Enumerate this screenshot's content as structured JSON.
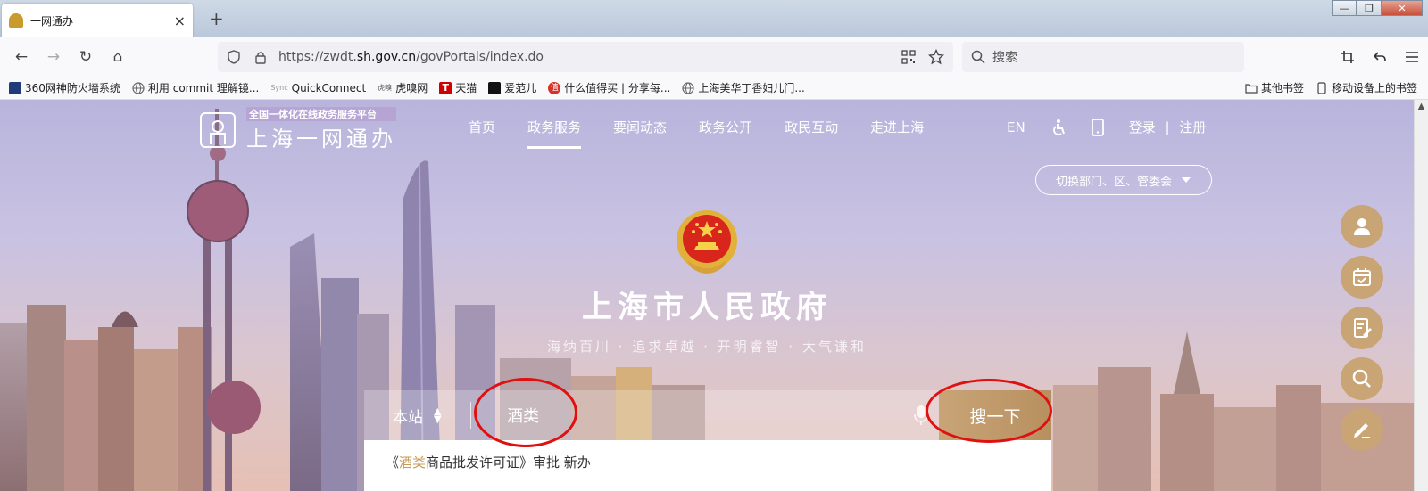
{
  "browser": {
    "tab": {
      "title": "一网通办",
      "close": "×"
    },
    "new_tab": "+",
    "window": {
      "minimize": "—",
      "restore": "❐",
      "close": "✕"
    },
    "nav": {
      "back": "←",
      "forward": "→",
      "reload": "↻",
      "home": "⌂"
    },
    "url": {
      "prefix": "https://zwdt.",
      "domain": "sh.gov.cn",
      "path": "/govPortals/index.do"
    },
    "search_placeholder": "搜索",
    "bookmarks": [
      {
        "label": "360网神防火墙系统",
        "color": "#1f3b7a"
      },
      {
        "label": "利用 commit 理解镜...",
        "color": "#777777"
      },
      {
        "label": "QuickConnect",
        "color": "#aaaaaa",
        "prefix": "Sync"
      },
      {
        "label": "虎嗅网",
        "color": "#555555",
        "prefix": "虎嗅"
      },
      {
        "label": "天猫",
        "color": "#d00000",
        "prefix": "T"
      },
      {
        "label": "爱范儿",
        "color": "#111111"
      },
      {
        "label": "什么值得买 | 分享每...",
        "color": "#d6322b",
        "prefix": "值"
      },
      {
        "label": "上海美华丁香妇儿门...",
        "color": "#777777"
      }
    ],
    "bookmarks_right": [
      "其他书签",
      "移动设备上的书签"
    ]
  },
  "site": {
    "logo_sub": "全国一体化在线政务服务平台",
    "logo_main": "上海一网通办",
    "nav": [
      "首页",
      "政务服务",
      "要闻动态",
      "政务公开",
      "政民互动",
      "走进上海"
    ],
    "nav_active_index": 1,
    "lang": "EN",
    "login": "登录",
    "separator": "|",
    "register": "注册",
    "switch_label": "切换部门、区、管委会",
    "gov_title": "上海市人民政府",
    "motto": "海纳百川 · 追求卓越 · 开明睿智 · 大气谦和",
    "search": {
      "scope": "本站",
      "value": "酒类",
      "button": "搜一下"
    },
    "suggestion": {
      "open": "《",
      "highlight": "酒类",
      "rest": "商品批发许可证》审批 新办"
    }
  },
  "colors": {
    "accent_gold": "#c8a476",
    "annotation_red": "#e01010",
    "sky_top": "#b8b4dc",
    "sky_bottom": "#e6c0b4"
  }
}
